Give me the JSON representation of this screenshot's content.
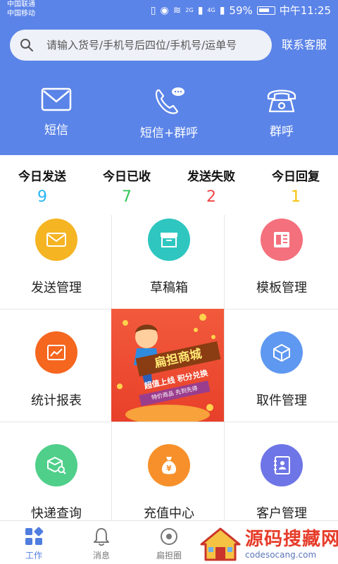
{
  "status_bar": {
    "carrier1": "中国联通",
    "carrier2": "中国移动",
    "network1": "2G",
    "network2": "4G",
    "battery": "59%",
    "time": "中午11:25"
  },
  "header": {
    "search_placeholder": "请输入货号/手机号后四位/手机号/运单号",
    "contact_label": "联系客服",
    "quick_actions": [
      {
        "label": "短信",
        "icon": "envelope-icon"
      },
      {
        "label": "短信+群呼",
        "icon": "phone-chat-icon"
      },
      {
        "label": "群呼",
        "icon": "telephone-icon"
      }
    ]
  },
  "stats": [
    {
      "title": "今日发送",
      "value": "9",
      "color": "#29b6f6"
    },
    {
      "title": "今日已收",
      "value": "7",
      "color": "#34c759"
    },
    {
      "title": "发送失败",
      "value": "2",
      "color": "#f04848"
    },
    {
      "title": "今日回复",
      "value": "1",
      "color": "#f5c20a"
    }
  ],
  "grid": [
    {
      "label": "发送管理",
      "color": "#f5b422",
      "icon": "envelope-icon"
    },
    {
      "label": "草稿箱",
      "color": "#2fc6c0",
      "icon": "archive-box-icon"
    },
    {
      "label": "模板管理",
      "color": "#f4707c",
      "icon": "template-icon"
    },
    {
      "label": "统计报表",
      "color": "#f5661e",
      "icon": "chart-icon"
    },
    {
      "label": "取件管理",
      "color": "#5f98f0",
      "icon": "package-icon"
    },
    {
      "label": "快递查询",
      "color": "#4fcf8a",
      "icon": "box-search-icon"
    },
    {
      "label": "充值中心",
      "color": "#f7902a",
      "icon": "money-bag-icon"
    },
    {
      "label": "客户管理",
      "color": "#6e75e6",
      "icon": "contacts-icon"
    }
  ],
  "promo": {
    "title": "扁担商城",
    "subtitle": "超值上线 积分兑换",
    "tag": "特价商品 先到先得"
  },
  "bottom_nav": [
    {
      "label": "工作",
      "icon": "grid-icon",
      "active": true
    },
    {
      "label": "消息",
      "icon": "bell-icon",
      "active": false
    },
    {
      "label": "扁担圈",
      "icon": "circle-icon",
      "active": false
    }
  ],
  "watermark": {
    "title": "源码搜藏网",
    "url": "codesocang.com"
  }
}
